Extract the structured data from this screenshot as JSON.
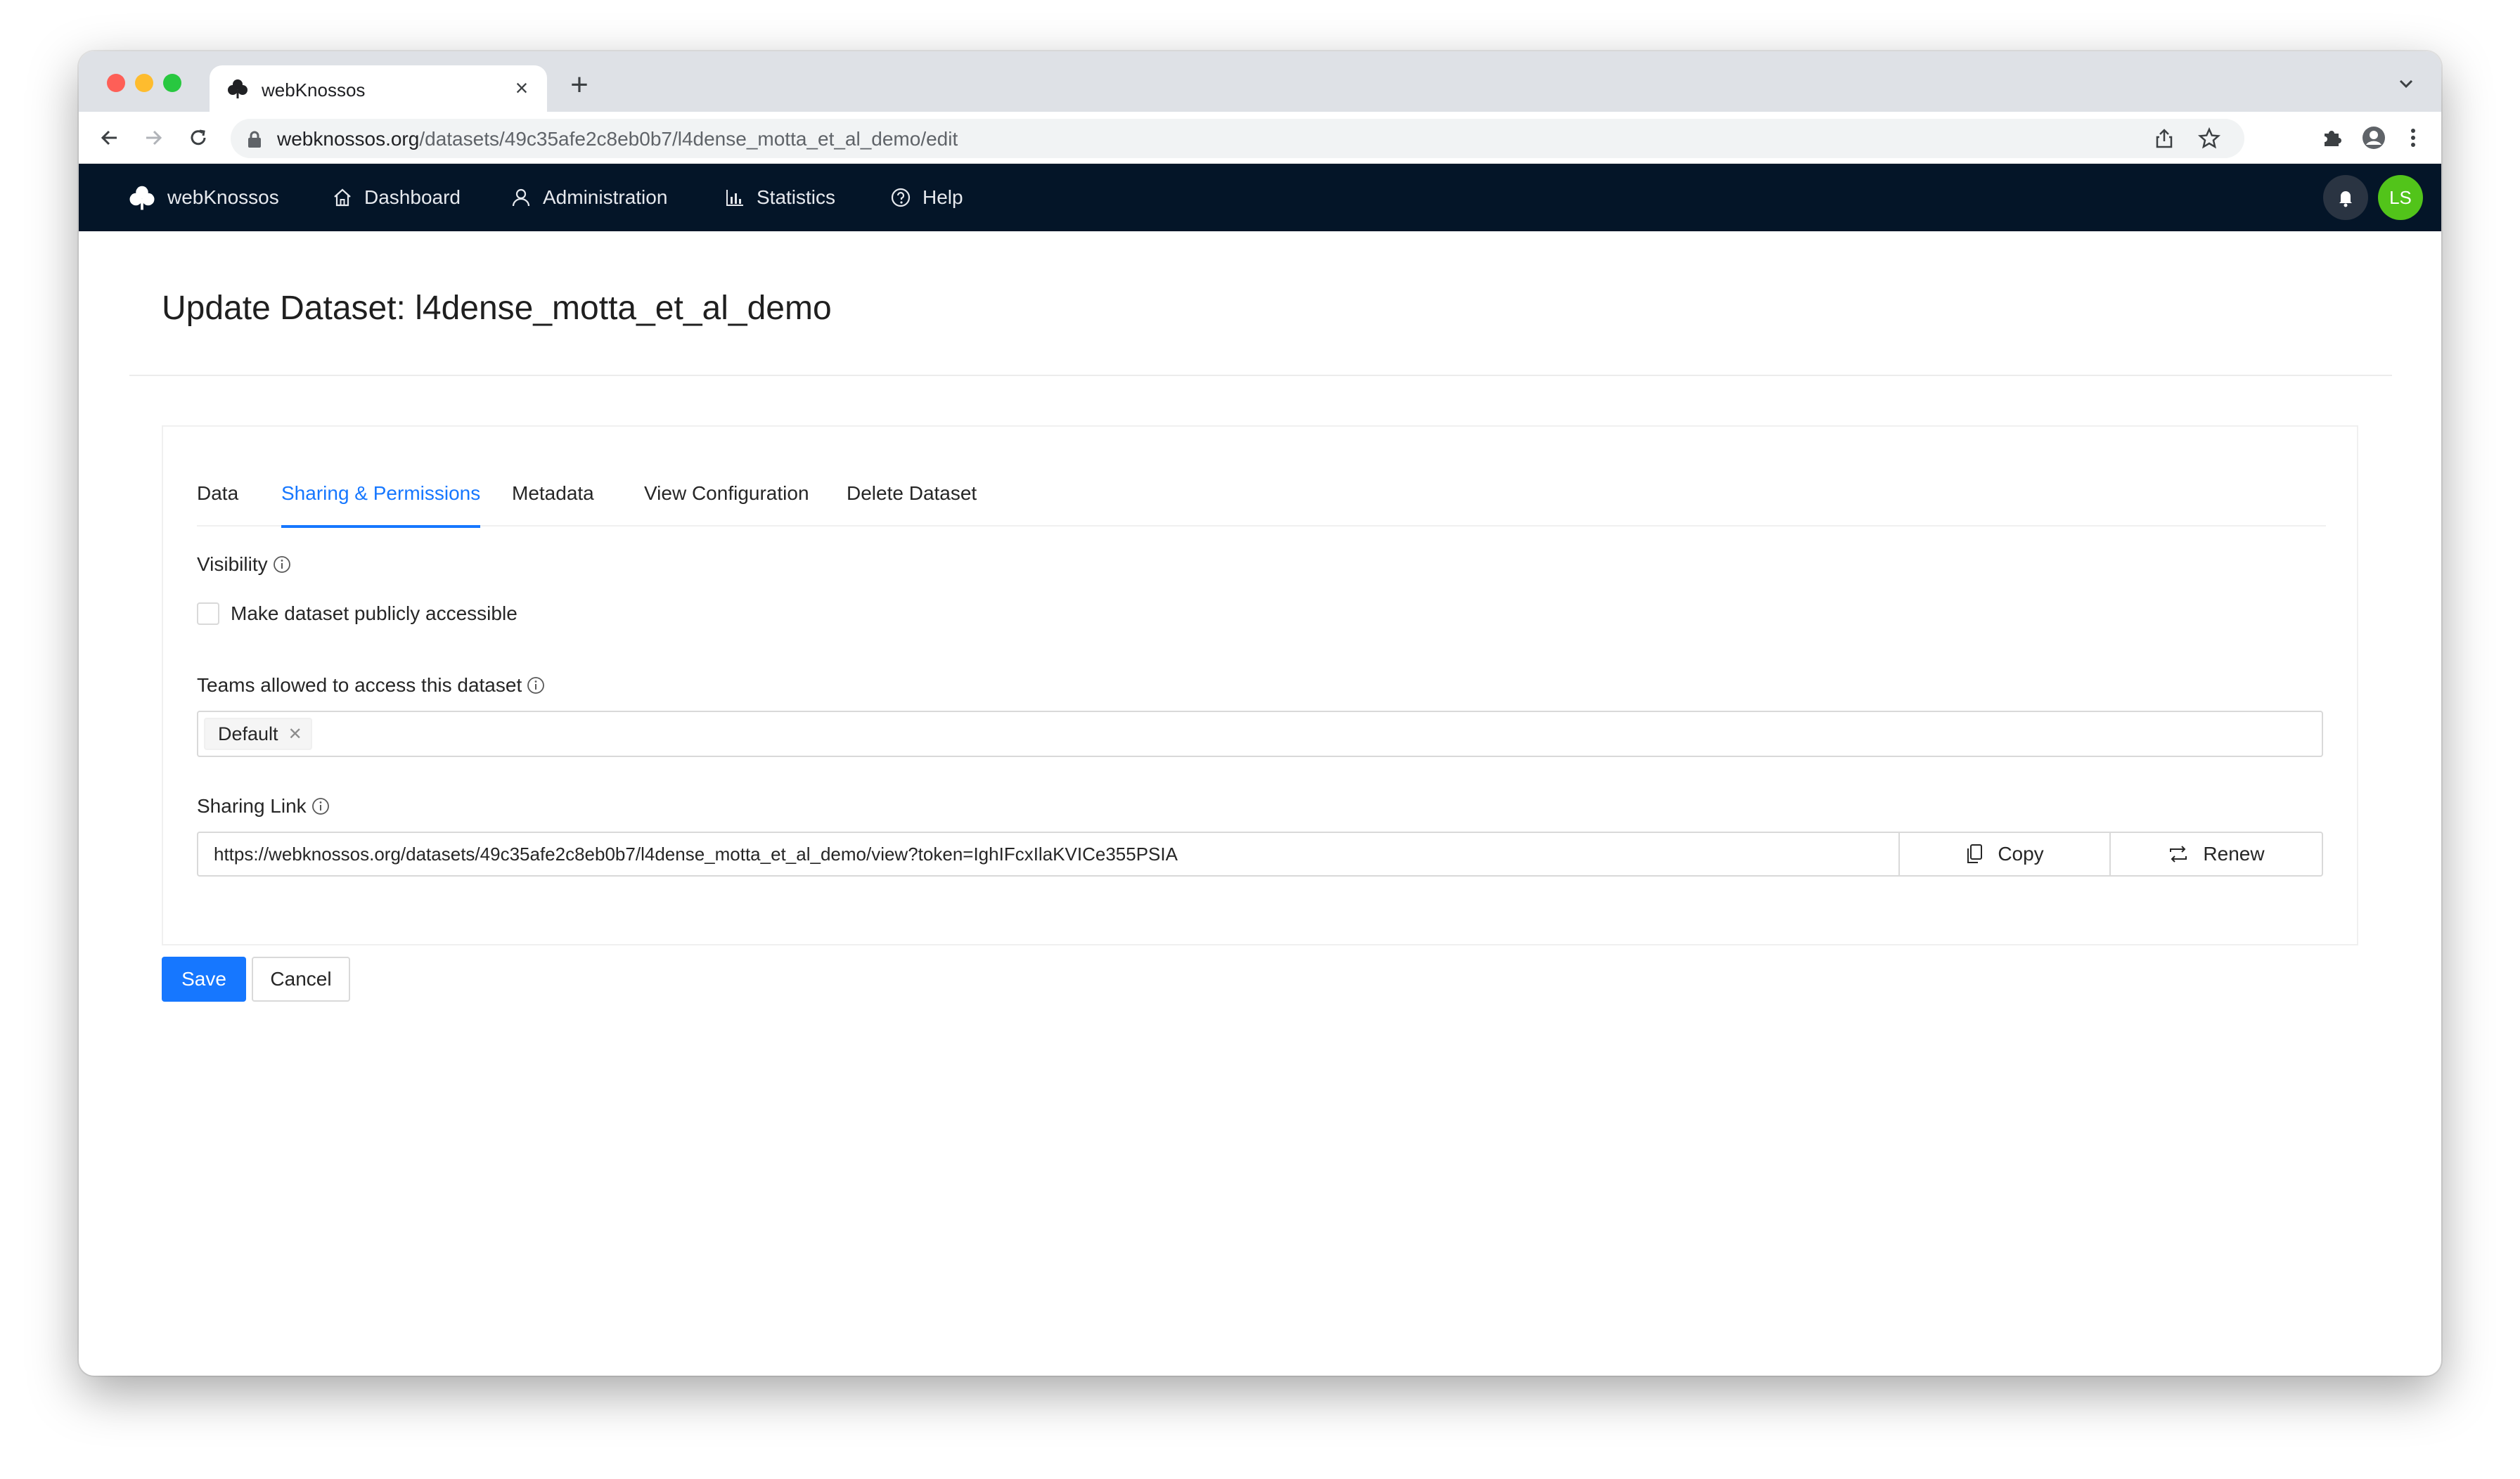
{
  "browser": {
    "tab_title": "webKnossos",
    "url_host": "webknossos.org",
    "url_path": "/datasets/49c35afe2c8eb0b7/l4dense_motta_et_al_demo/edit"
  },
  "appnav": {
    "brand": "webKnossos",
    "items": [
      {
        "label": "Dashboard",
        "icon": "home-icon"
      },
      {
        "label": "Administration",
        "icon": "user-admin-icon"
      },
      {
        "label": "Statistics",
        "icon": "bar-chart-icon"
      },
      {
        "label": "Help",
        "icon": "question-circle-icon"
      }
    ],
    "avatar_initials": "LS"
  },
  "page": {
    "title": "Update Dataset: l4dense_motta_et_al_demo"
  },
  "tabs": [
    {
      "label": "Data",
      "active": false
    },
    {
      "label": "Sharing & Permissions",
      "active": true
    },
    {
      "label": "Metadata",
      "active": false
    },
    {
      "label": "View Configuration",
      "active": false
    },
    {
      "label": "Delete Dataset",
      "active": false
    }
  ],
  "form": {
    "visibility_label": "Visibility",
    "public_checkbox_label": "Make dataset publicly accessible",
    "public_checked": false,
    "teams_label": "Teams allowed to access this dataset",
    "teams": [
      "Default"
    ],
    "sharing_label": "Sharing Link",
    "sharing_link": "https://webknossos.org/datasets/49c35afe2c8eb0b7/l4dense_motta_et_al_demo/view?token=IghIFcxIlaKVICe355PSIA",
    "copy_label": "Copy",
    "renew_label": "Renew"
  },
  "actions": {
    "save_label": "Save",
    "cancel_label": "Cancel"
  },
  "colors": {
    "nav_bg": "#041528",
    "primary": "#1677ff",
    "avatar": "#52c41a"
  }
}
